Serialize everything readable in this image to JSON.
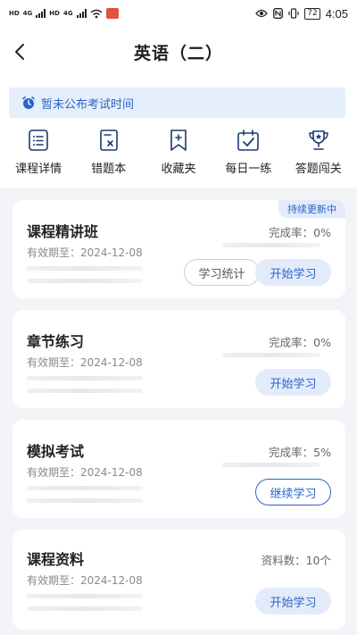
{
  "status_bar": {
    "left_tags": [
      "HD",
      "4G",
      "HD",
      "4G"
    ],
    "battery": "72",
    "time": "4:05"
  },
  "header": {
    "title": "英语（二）"
  },
  "notice": {
    "text": "暂未公布考试时间"
  },
  "quick_nav": [
    {
      "label": "课程详情",
      "icon": "list-icon"
    },
    {
      "label": "错题本",
      "icon": "wrong-book-icon"
    },
    {
      "label": "收藏夹",
      "icon": "bookmark-icon"
    },
    {
      "label": "每日一练",
      "icon": "calendar-check-icon"
    },
    {
      "label": "答题闯关",
      "icon": "trophy-icon"
    }
  ],
  "cards": [
    {
      "title": "课程精讲班",
      "ribbon": "持续更新中",
      "expiry": "有效期至：2024-12-08",
      "stat_label": "完成率：",
      "stat_value": "0%",
      "secondary_button": "学习统计",
      "button": "开始学习"
    },
    {
      "title": "章节练习",
      "expiry": "有效期至：2024-12-08",
      "stat_label": "完成率：",
      "stat_value": "0%",
      "button": "开始学习"
    },
    {
      "title": "模拟考试",
      "expiry": "有效期至：2024-12-08",
      "stat_label": "完成率：",
      "stat_value": "5%",
      "button": "继续学习"
    },
    {
      "title": "课程资料",
      "expiry": "有效期至：2024-12-08",
      "stat_label": "资料数：",
      "stat_value": "10个",
      "button": "开始学习"
    }
  ],
  "colors": {
    "accent": "#2b64c8",
    "accent_light": "#e3ebfa",
    "notice_bg": "#e5eefb",
    "page_bg": "#f3f4f8"
  }
}
